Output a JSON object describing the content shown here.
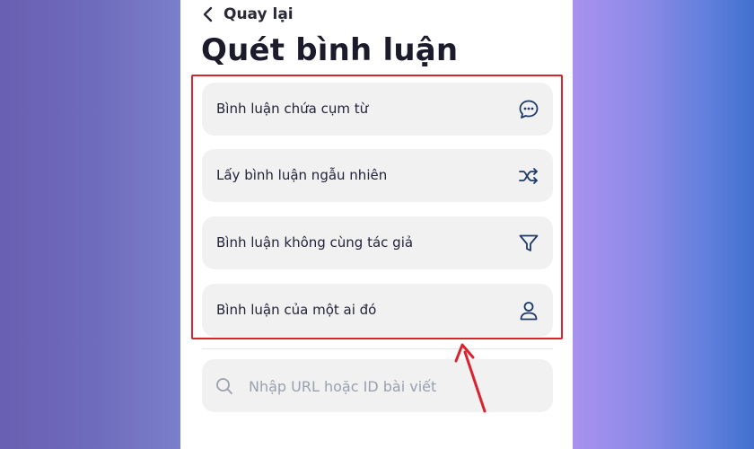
{
  "header": {
    "back_label": "Quay lại",
    "title": "Quét bình luận"
  },
  "menu": {
    "items": [
      {
        "label": "Bình luận chứa cụm từ",
        "icon": "chat-bubble-icon"
      },
      {
        "label": "Lấy bình luận ngẫu nhiên",
        "icon": "shuffle-icon"
      },
      {
        "label": "Bình luận không cùng tác giả",
        "icon": "filter-icon"
      },
      {
        "label": "Bình luận của một ai đó",
        "icon": "user-icon"
      }
    ]
  },
  "search": {
    "placeholder": "Nhập URL hoặc ID bài viết",
    "value": ""
  },
  "colors": {
    "text_primary": "#1b1b2b",
    "item_background": "#f1f1f2",
    "icon_color": "#1e3a66",
    "highlight": "#d9232e"
  }
}
